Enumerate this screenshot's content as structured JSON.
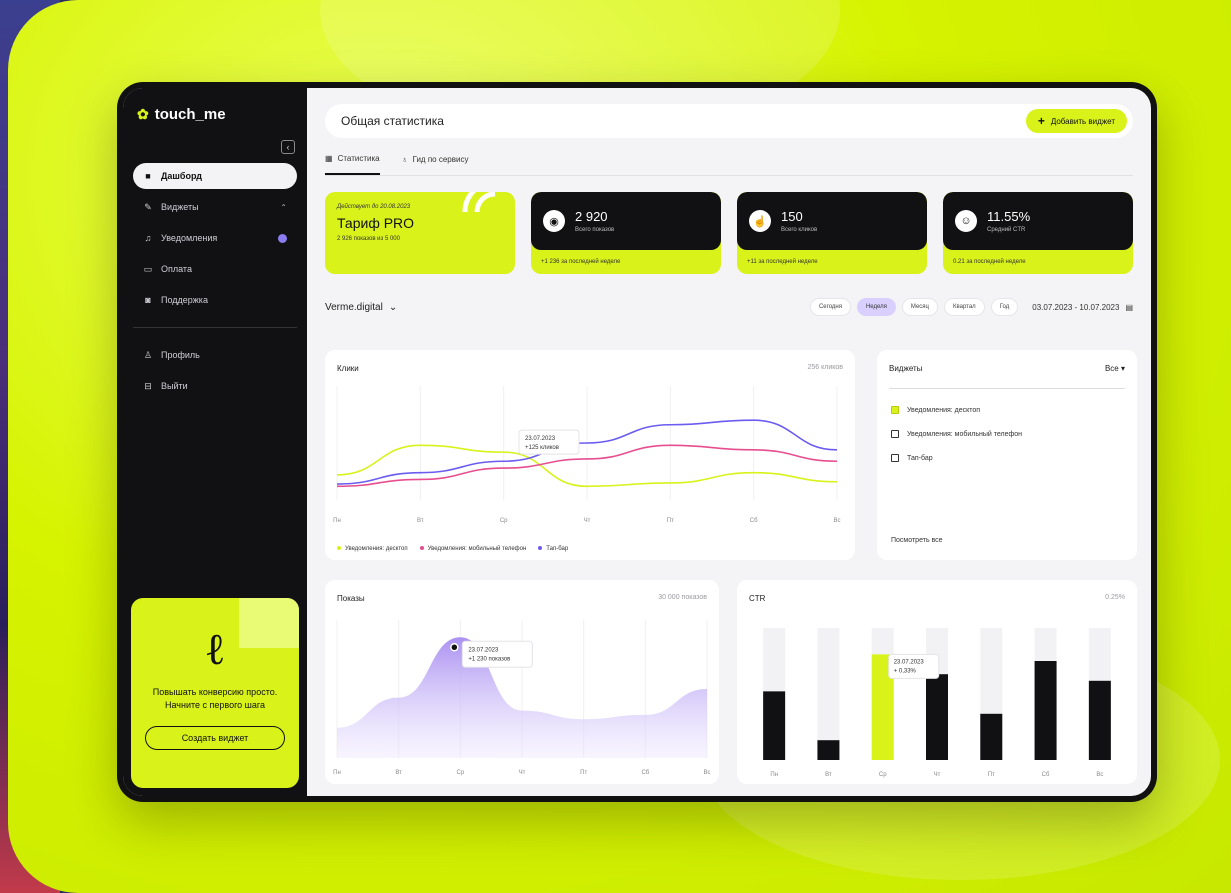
{
  "brand": {
    "name": "touch_me",
    "accent": "#d8f21a",
    "dark": "#111114",
    "violet": "#8b7cf0"
  },
  "sidebar": {
    "items": [
      {
        "label": "Дашборд",
        "icon": "dashboard-icon",
        "active": true
      },
      {
        "label": "Виджеты",
        "icon": "widgets-icon"
      },
      {
        "label": "Уведомления",
        "icon": "bell-icon"
      },
      {
        "label": "Оплата",
        "icon": "card-icon"
      },
      {
        "label": "Поддержка",
        "icon": "support-icon"
      }
    ],
    "bottom_items": [
      {
        "label": "Профиль",
        "icon": "user-icon"
      },
      {
        "label": "Выйти",
        "icon": "logout-icon"
      }
    ],
    "promo": {
      "text": "Повышать конверсию просто. Начните с первого шага",
      "button": "Создать виджет"
    }
  },
  "header": {
    "title": "Общая статистика",
    "add_button": "Добавить виджет"
  },
  "tabs": [
    {
      "label": "Статистика",
      "icon": "grid-icon",
      "active": true
    },
    {
      "label": "Гид по сервису",
      "icon": "lightbulb-icon"
    }
  ],
  "plan": {
    "subtitle": "Действует до 20.08.2023",
    "name": "Тариф PRO",
    "quota": "2 926 показов из 5 000"
  },
  "stats": [
    {
      "value": "2 920",
      "label": "Всего показов",
      "delta": "+1 236 за последней неделе",
      "icon": "eye-icon"
    },
    {
      "value": "150",
      "label": "Всего кликов",
      "delta": "+11 за последней неделе",
      "icon": "pointer-icon"
    },
    {
      "value": "11.55%",
      "label": "Средний CTR",
      "delta": "0.21 за последней неделе",
      "icon": "ctr-icon"
    }
  ],
  "filters": {
    "project": "Verme.digital",
    "periods": [
      {
        "label": "Сегодня"
      },
      {
        "label": "Неделя",
        "active": true
      },
      {
        "label": "Месяц"
      },
      {
        "label": "Квартал"
      },
      {
        "label": "Год"
      }
    ],
    "date_range": "03.07.2023 - 10.07.2023"
  },
  "clicks_panel": {
    "title": "Клики",
    "meta": "256 кликов",
    "tooltip_date": "23.07.2023",
    "tooltip_value": "+125 кликов",
    "legend": [
      {
        "name": "Уведомления: десктоп",
        "color": "#d8f21a"
      },
      {
        "name": "Уведомления: мобильный телефон",
        "color": "#e64e8f"
      },
      {
        "name": "Тап-бар",
        "color": "#6b5cf0"
      }
    ]
  },
  "widgets_panel": {
    "title": "Виджеты",
    "filter": "Все",
    "items": [
      {
        "label": "Уведомления: десктоп",
        "checked": true
      },
      {
        "label": "Уведомления: мобильный телефон",
        "checked": false
      },
      {
        "label": "Тап-бар",
        "checked": false
      }
    ],
    "view_all": "Посмотреть все"
  },
  "views_panel": {
    "title": "Показы",
    "meta": "30 000 показов",
    "tooltip_date": "23.07.2023",
    "tooltip_value": "+1 230 показов"
  },
  "ctr_panel": {
    "title": "CTR",
    "meta": "0.25%",
    "tooltip_date": "23.07.2023",
    "tooltip_value": "+ 0,33%"
  },
  "chart_data": [
    {
      "type": "line",
      "categories": [
        "Пн",
        "Вт",
        "Ср",
        "Чт",
        "Пт",
        "Сб",
        "Вс"
      ],
      "series": [
        {
          "name": "Уведомления: десктоп",
          "values": [
            22,
            48,
            42,
            12,
            15,
            24,
            16
          ]
        },
        {
          "name": "Уведомления: мобильный телефон",
          "values": [
            12,
            18,
            28,
            36,
            48,
            44,
            34
          ]
        },
        {
          "name": "Тап-бар",
          "values": [
            14,
            24,
            34,
            50,
            66,
            70,
            44
          ]
        }
      ],
      "ylim": [
        0,
        100
      ]
    },
    {
      "type": "area",
      "categories": [
        "Пн",
        "Вт",
        "Ср",
        "Чт",
        "Пт",
        "Сб",
        "Вс"
      ],
      "values": [
        35,
        70,
        140,
        55,
        45,
        50,
        80
      ],
      "ylim": [
        0,
        160
      ]
    },
    {
      "type": "bar",
      "categories": [
        "Пн",
        "Вт",
        "Ср",
        "Чт",
        "Пт",
        "Сб",
        "Вс"
      ],
      "values": [
        0.52,
        0.15,
        0.8,
        0.65,
        0.35,
        0.75,
        0.6
      ],
      "highlight_index": 2,
      "ylim": [
        0,
        1
      ]
    }
  ]
}
